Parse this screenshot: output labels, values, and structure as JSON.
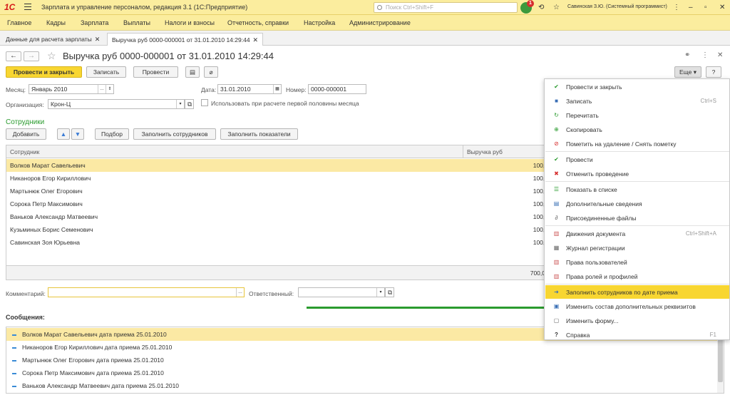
{
  "window": {
    "logo": "1С",
    "title": "Зарплата и управление персоналом, редакция 3.1  (1С:Предприятие)",
    "search_placeholder": "Поиск Ctrl+Shift+F",
    "notifications": "1",
    "user": "Савинская З.Ю. (Системный программист)"
  },
  "menu": [
    "Главное",
    "Кадры",
    "Зарплата",
    "Выплаты",
    "Налоги и взносы",
    "Отчетность, справки",
    "Настройка",
    "Администрирование"
  ],
  "tabs": [
    {
      "label": "Данные для расчета зарплаты"
    },
    {
      "label": "Выручка руб 0000-000001 от 31.01.2010 14:29:44"
    }
  ],
  "document": {
    "title": "Выручка руб 0000-000001 от 31.01.2010 14:29:44",
    "btn_post_close": "Провести и закрыть",
    "btn_save": "Записать",
    "btn_post": "Провести",
    "btn_more": "Еще",
    "btn_help": "?",
    "month_label": "Месяц:",
    "month_value": "Январь 2010",
    "date_label": "Дата:",
    "date_value": "31.01.2010",
    "number_label": "Номер:",
    "number_value": "0000-000001",
    "org_label": "Организация:",
    "org_value": "Крон-Ц",
    "first_half_label": "Использовать при расчете первой половины месяца",
    "section_title": "Сотрудники",
    "btn_add": "Добавить",
    "btn_pick": "Подбор",
    "btn_fill_employees": "Заполнить сотрудников",
    "btn_fill_indicators": "Заполнить показатели",
    "comment_label": "Комментарий:",
    "responsible_label": "Ответственный:"
  },
  "table": {
    "columns": [
      "Сотрудник",
      "Выручка руб"
    ],
    "rows": [
      {
        "name": "Волков Марат Савельевич",
        "value": "100,0"
      },
      {
        "name": "Никаноров Егор Кириллович",
        "value": "100,0"
      },
      {
        "name": "Мартынюк Олег Егорович",
        "value": "100,0"
      },
      {
        "name": "Сорока Петр Максимович",
        "value": "100,0"
      },
      {
        "name": "Ваньков Александр Матвеевич",
        "value": "100,0"
      },
      {
        "name": "Кузьминых Борис Семенович",
        "value": "100,0"
      },
      {
        "name": "Савинская Зоя Юрьевна",
        "value": "100,0"
      }
    ],
    "total": "700,0"
  },
  "messages": {
    "title": "Сообщения:",
    "items": [
      "Волков Марат Савельевич дата приема 25.01.2010",
      "Никаноров Егор Кириллович дата приема 25.01.2010",
      "Мартынюк Олег Егорович дата приема 25.01.2010",
      "Сорока Петр Максимович дата приема 25.01.2010",
      "Ваньков Александр Матвеевич дата приема 25.01.2010"
    ]
  },
  "dropdown": {
    "items": [
      {
        "label": "Провести и закрыть",
        "shortcut": "",
        "icon": "post-close-icon"
      },
      {
        "label": "Записать",
        "shortcut": "Ctrl+S",
        "icon": "save-icon"
      },
      {
        "label": "Перечитать",
        "shortcut": "",
        "icon": "reload-icon"
      },
      {
        "label": "Скопировать",
        "shortcut": "",
        "icon": "copy-icon"
      },
      {
        "label": "Пометить на удаление / Снять пометку",
        "shortcut": "",
        "icon": "delete-mark-icon"
      },
      {
        "label": "Провести",
        "shortcut": "",
        "icon": "post-icon"
      },
      {
        "label": "Отменить проведение",
        "shortcut": "",
        "icon": "unpost-icon"
      },
      {
        "label": "Показать в списке",
        "shortcut": "",
        "icon": "list-icon"
      },
      {
        "label": "Дополнительные сведения",
        "shortcut": "",
        "icon": "info-icon"
      },
      {
        "label": "Присоединенные файлы",
        "shortcut": "",
        "icon": "paperclip-icon"
      },
      {
        "label": "Движения документа",
        "shortcut": "Ctrl+Shift+A",
        "icon": "movements-icon"
      },
      {
        "label": "Журнал регистрации",
        "shortcut": "",
        "icon": "journal-icon"
      },
      {
        "label": "Права пользователей",
        "shortcut": "",
        "icon": "rights-icon"
      },
      {
        "label": "Права ролей и профилей",
        "shortcut": "",
        "icon": "roles-icon"
      },
      {
        "label": "Заполнить сотрудников по дате приема",
        "shortcut": "",
        "icon": "fill-icon"
      },
      {
        "label": "Изменить состав дополнительных реквизитов",
        "shortcut": "",
        "icon": "attributes-icon"
      },
      {
        "label": "Изменить форму...",
        "shortcut": "",
        "icon": "form-icon"
      },
      {
        "label": "Справка",
        "shortcut": "F1",
        "icon": "help-icon"
      }
    ]
  }
}
